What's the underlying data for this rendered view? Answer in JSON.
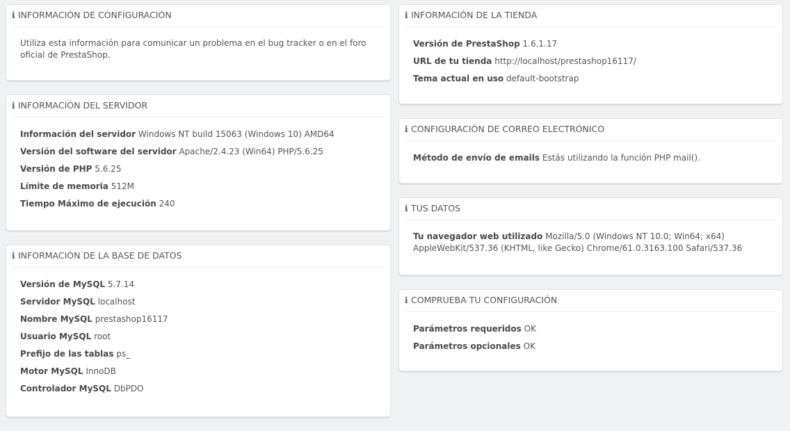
{
  "config_info": {
    "title": "INFORMACIÓN DE CONFIGURACIÓN",
    "text": "Utiliza esta información para comunicar un problema en el bug tracker o en el foro oficial de PrestaShop."
  },
  "server_info": {
    "title": "INFORMACIÓN DEL SERVIDOR",
    "rows": [
      {
        "label": "Información del servidor",
        "value": "Windows NT build 15063 (Windows 10) AMD64"
      },
      {
        "label": "Versión del software del servidor",
        "value": "Apache/2.4.23 (Win64) PHP/5.6.25"
      },
      {
        "label": "Versión de PHP",
        "value": "5.6.25"
      },
      {
        "label": "Límite de memoria",
        "value": "512M"
      },
      {
        "label": "Tiempo Máximo de ejecución",
        "value": "240"
      }
    ]
  },
  "db_info": {
    "title": "INFORMACIÓN DE LA BASE DE DATOS",
    "rows": [
      {
        "label": "Versión de MySQL",
        "value": "5.7.14"
      },
      {
        "label": "Servidor MySQL",
        "value": "localhost"
      },
      {
        "label": "Nombre MySQL",
        "value": "prestashop16117"
      },
      {
        "label": "Usuario MySQL",
        "value": "root"
      },
      {
        "label": "Prefijo de las tablas",
        "value": "ps_"
      },
      {
        "label": "Motor MySQL",
        "value": "InnoDB"
      },
      {
        "label": "Controlador MySQL",
        "value": "DbPDO"
      }
    ]
  },
  "store_info": {
    "title": "INFORMACIÓN DE LA TIENDA",
    "rows": [
      {
        "label": "Versión de PrestaShop",
        "value": "1.6.1.17"
      },
      {
        "label": "URL de tu tienda",
        "value": "http://localhost/prestashop16117/"
      },
      {
        "label": "Tema actual en uso",
        "value": "default-bootstrap"
      }
    ]
  },
  "mail_config": {
    "title": "CONFIGURACIÓN DE CORREO ELECTRÓNICO",
    "rows": [
      {
        "label": "Método de envío de emails",
        "value": "Estás utilizando la función PHP mail()."
      }
    ]
  },
  "your_data": {
    "title": "TUS DATOS",
    "rows": [
      {
        "label": "Tu navegador web utilizado",
        "value": "Mozilla/5.0 (Windows NT 10.0; Win64; x64) AppleWebKit/537.36 (KHTML, like Gecko) Chrome/61.0.3163.100 Safari/537.36"
      }
    ]
  },
  "check_config": {
    "title": "COMPRUEBA TU CONFIGURACIÓN",
    "rows": [
      {
        "label": "Parámetros requeridos",
        "value": "OK"
      },
      {
        "label": "Parámetros opcionales",
        "value": "OK"
      }
    ]
  },
  "icons": {
    "panel_heading": "info-icon"
  }
}
